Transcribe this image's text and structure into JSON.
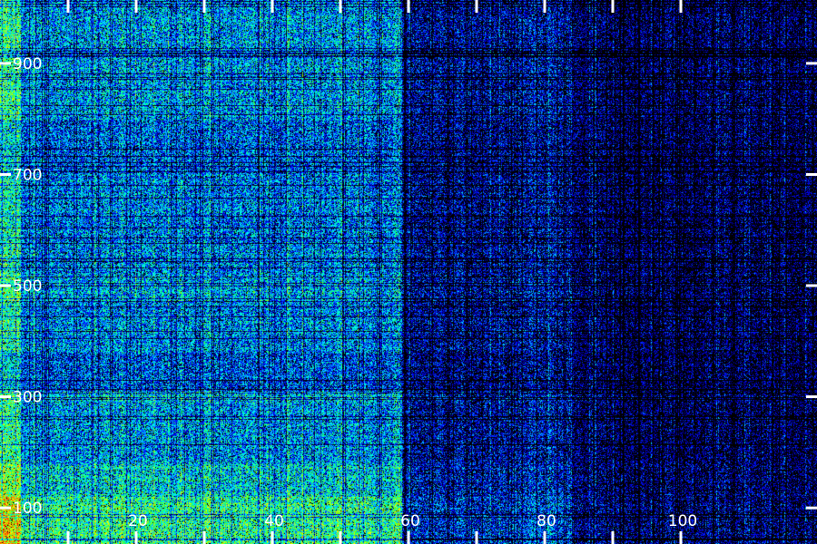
{
  "chart_data": {
    "type": "heatmap",
    "title": "",
    "xlabel": "",
    "ylabel": "",
    "x_ticks": [
      {
        "value": 10,
        "label": ""
      },
      {
        "value": 20,
        "label": "20"
      },
      {
        "value": 30,
        "label": ""
      },
      {
        "value": 40,
        "label": "40"
      },
      {
        "value": 50,
        "label": ""
      },
      {
        "value": 60,
        "label": "60"
      },
      {
        "value": 70,
        "label": ""
      },
      {
        "value": 80,
        "label": "80"
      },
      {
        "value": 90,
        "label": ""
      },
      {
        "value": 100,
        "label": "100"
      }
    ],
    "y_ticks": [
      {
        "value": 100,
        "label": "100"
      },
      {
        "value": 300,
        "label": "300"
      },
      {
        "value": 500,
        "label": "500"
      },
      {
        "value": 700,
        "label": "700"
      },
      {
        "value": 900,
        "label": "900"
      }
    ],
    "xlim": [
      0,
      120
    ],
    "ylim": [
      35,
      1014
    ],
    "colormap": [
      "#000000",
      "#00008b",
      "#0000ff",
      "#0080ff",
      "#00ffff",
      "#00ff80",
      "#80ff00",
      "#ffff00",
      "#ff8000",
      "#ff0000"
    ],
    "tick_color": "#ffffff",
    "intensity_profile": {
      "column_bands": [
        {
          "x_from": 0,
          "x_to": 3,
          "level": 0.8
        },
        {
          "x_from": 3,
          "x_to": 59,
          "level": 0.55
        },
        {
          "x_from": 59,
          "x_to": 75,
          "level": 0.25
        },
        {
          "x_from": 75,
          "x_to": 84,
          "level": 0.3
        },
        {
          "x_from": 84,
          "x_to": 120,
          "level": 0.12
        }
      ],
      "row_bands": [
        {
          "y_from": 35,
          "y_to": 120,
          "level": 1.0
        },
        {
          "y_from": 120,
          "y_to": 180,
          "level": 0.75
        },
        {
          "y_from": 180,
          "y_to": 290,
          "level": 0.55
        },
        {
          "y_from": 290,
          "y_to": 310,
          "level": 0.7
        },
        {
          "y_from": 310,
          "y_to": 380,
          "level": 0.3
        },
        {
          "y_from": 380,
          "y_to": 470,
          "level": 0.5
        },
        {
          "y_from": 470,
          "y_to": 520,
          "level": 0.6
        },
        {
          "y_from": 520,
          "y_to": 700,
          "level": 0.45
        },
        {
          "y_from": 700,
          "y_to": 800,
          "level": 0.35
        },
        {
          "y_from": 800,
          "y_to": 1014,
          "level": 0.55
        }
      ]
    }
  }
}
